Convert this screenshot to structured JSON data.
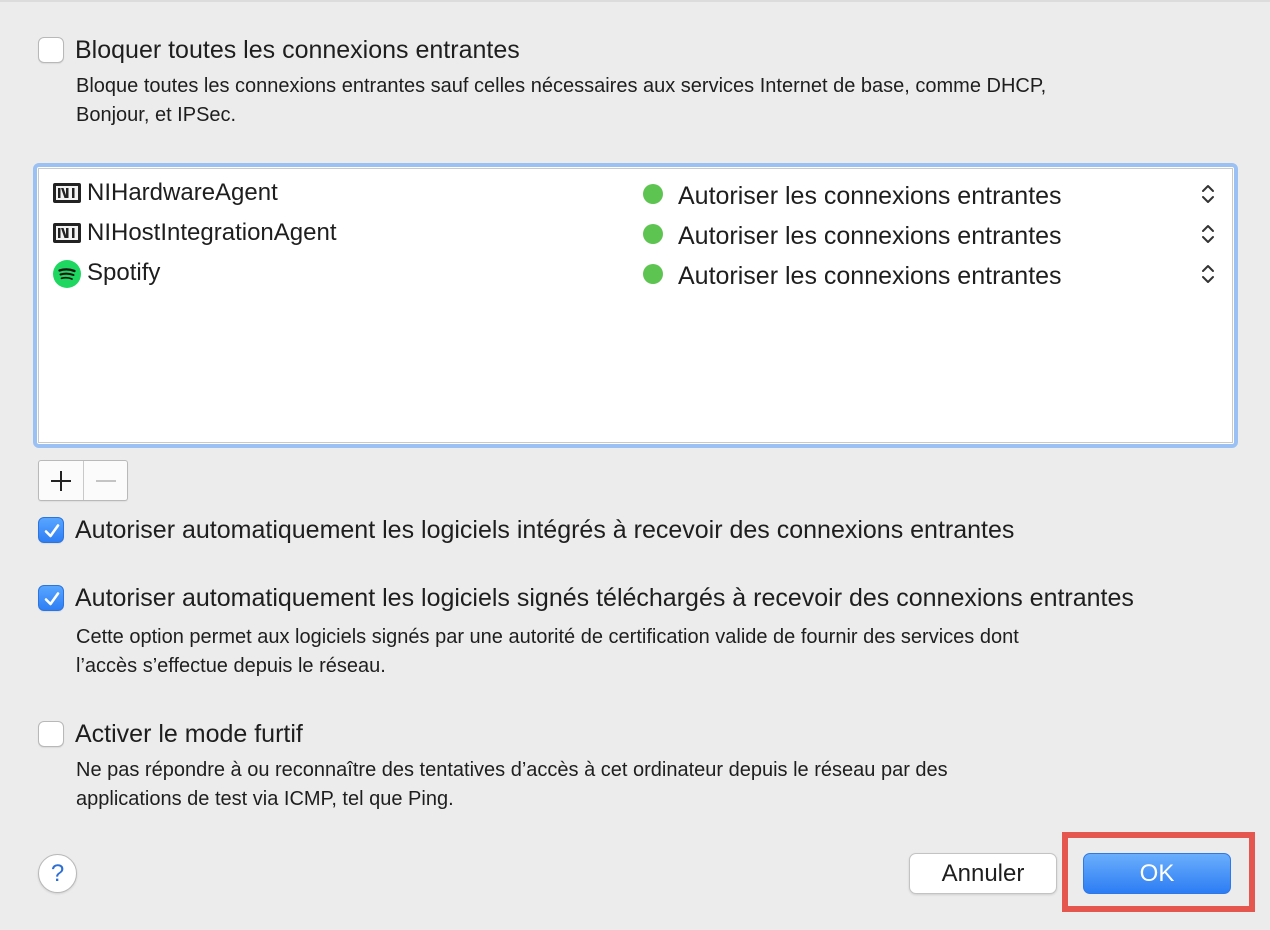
{
  "block_all": {
    "label": "Bloquer toutes les connexions entrantes",
    "checked": false,
    "description_line1": "Bloque toutes les connexions entrantes sauf celles nécessaires aux services Internet de base, comme DHCP,",
    "description_line2": "Bonjour, et IPSec."
  },
  "apps": [
    {
      "name": "NIHardwareAgent",
      "icon": "native-instruments-icon",
      "status": "Autoriser les connexions entrantes",
      "status_color": "#5ec451"
    },
    {
      "name": "NIHostIntegrationAgent",
      "icon": "native-instruments-icon",
      "status": "Autoriser les connexions entrantes",
      "status_color": "#5ec451"
    },
    {
      "name": "Spotify",
      "icon": "spotify-icon",
      "status": "Autoriser les connexions entrantes",
      "status_color": "#5ec451"
    }
  ],
  "list_controls": {
    "add": "+",
    "remove": "−"
  },
  "auto_builtin": {
    "label": "Autoriser automatiquement les logiciels intégrés à recevoir des connexions entrantes",
    "checked": true
  },
  "auto_signed": {
    "label": "Autoriser automatiquement les logiciels signés téléchargés à recevoir des connexions entrantes",
    "checked": true,
    "description_line1": "Cette option permet aux logiciels signés par une autorité de certification valide de fournir des services dont",
    "description_line2": "l’accès s’effectue depuis le réseau."
  },
  "stealth": {
    "label": "Activer le mode furtif",
    "checked": false,
    "description_line1": "Ne pas répondre à ou reconnaître des tentatives d’accès à cet ordinateur depuis le réseau par des",
    "description_line2": "applications de test via ICMP, tel que Ping."
  },
  "help": "?",
  "buttons": {
    "cancel": "Annuler",
    "ok": "OK"
  },
  "colors": {
    "accent": "#2d7df4",
    "highlight": "#e5564e",
    "allowed": "#5ec451"
  }
}
